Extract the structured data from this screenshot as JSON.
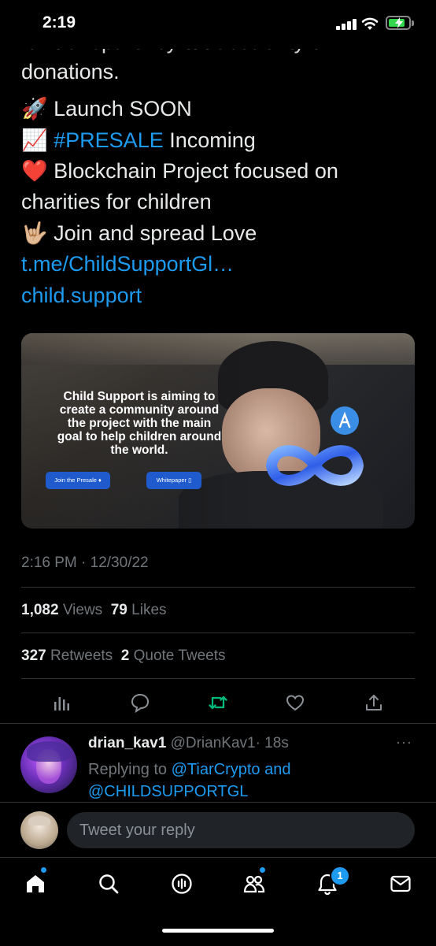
{
  "status_bar": {
    "time": "2:19"
  },
  "tweet": {
    "cut_top_line": "full transparency & traceability of",
    "line_donations": "donations.",
    "launch_emoji": "🚀",
    "launch_text": "Launch SOON",
    "presale_emoji": "📈",
    "presale_hashtag": "#PRESALE",
    "presale_text": "Incoming",
    "heart_emoji": "❤️",
    "blockchain_line1": "Blockchain Project focused on",
    "blockchain_line2": "charities for children",
    "love_emoji": "🤟🏼",
    "love_text": "Join and spread Love",
    "link_telegram": "t.me/ChildSupportGl…",
    "link_site": "child.support"
  },
  "media": {
    "headline_lines": [
      "Child Support is aiming to",
      "create a community around",
      "the project with the main",
      "goal to help children around",
      "the world."
    ],
    "presale_button": "Join the Presale",
    "whitepaper_button": "Whitepaper"
  },
  "meta": {
    "timestamp": "2:16 PM · 12/30/22",
    "views_count": "1,082",
    "views_label": "Views",
    "likes_count": "79",
    "likes_label": "Likes",
    "retweets_count": "327",
    "retweets_label": "Retweets",
    "quotes_count": "2",
    "quotes_label": "Quote Tweets"
  },
  "actions": [
    "analytics-icon",
    "reply-icon",
    "retweet-icon",
    "like-icon",
    "share-icon"
  ],
  "reply": {
    "display_name": "drian_kav1",
    "handle": "@DrianKav1",
    "time": "· 18s",
    "more": "···",
    "replying_prefix": "Replying to",
    "replying_user1": "@TiarCrypto",
    "replying_and": "and",
    "replying_user2": "@CHILDSUPPORTGL"
  },
  "compose": {
    "placeholder": "Tweet your reply"
  },
  "tab_bar": {
    "notifications_badge": "1"
  },
  "colors": {
    "accent": "#1d9bf0",
    "retweet": "#00ba7c",
    "background": "#000000",
    "muted": "#71767b"
  }
}
